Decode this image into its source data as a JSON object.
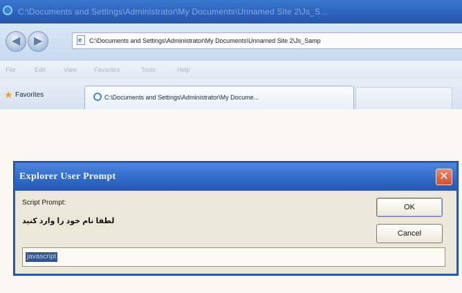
{
  "window": {
    "title": "C:\\Documents and Settings\\Administrator\\My Documents\\Unnamed Site 2\\Js_S..."
  },
  "addressbar": {
    "back_icon": "back-arrow-icon",
    "forward_icon": "forward-arrow-icon",
    "url": "C:\\Documents and Settings\\Administrator\\My Documents\\Unnamed Site 2\\Js_Samp"
  },
  "menubar": {
    "items": [
      "File",
      "Edit",
      "View",
      "Favorites",
      "Tools",
      "Help"
    ]
  },
  "favorites": {
    "label": "Favorites",
    "tab_label": "C:\\Documents and Settings\\Administrator\\My Docume..."
  },
  "dialog": {
    "title": "Explorer User Prompt",
    "close_glyph": "✕",
    "prompt_label": "Script Prompt:",
    "message": "لطفا نام خود را وارد کنید",
    "ok_label": "OK",
    "cancel_label": "Cancel",
    "input_value": "javascript"
  },
  "colors": {
    "titlebar": "#2c63bd",
    "dialog_title": "#2f68c6",
    "close_button": "#d4502f",
    "selection": "#31558f"
  }
}
